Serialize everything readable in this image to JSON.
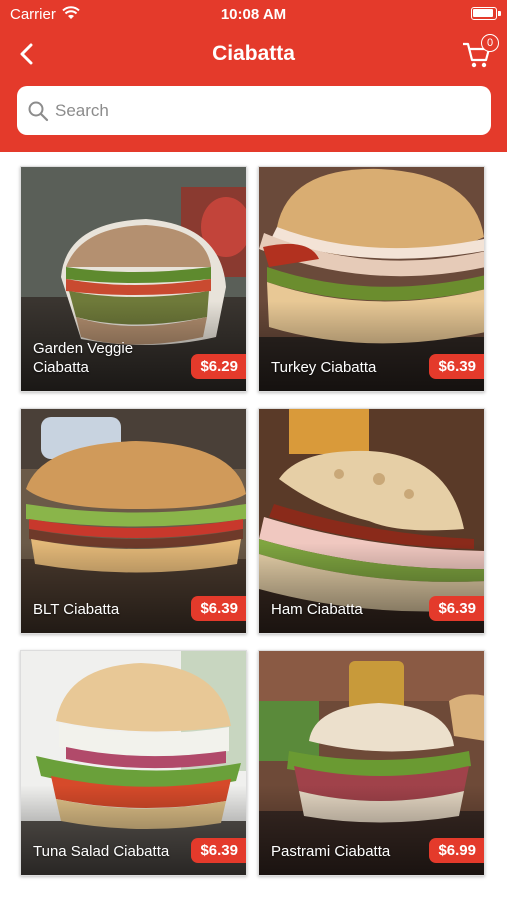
{
  "status_bar": {
    "carrier": "Carrier",
    "time": "10:08 AM"
  },
  "nav": {
    "title": "Ciabatta",
    "back_icon": "chevron-left-icon",
    "cart_icon": "cart-icon",
    "cart_count": "0"
  },
  "search": {
    "placeholder": "Search",
    "value": ""
  },
  "colors": {
    "brand": "#e43a2b",
    "white": "#ffffff"
  },
  "products": [
    {
      "name": "Garden Veggie Ciabatta",
      "price": "$6.29"
    },
    {
      "name": "Turkey Ciabatta",
      "price": "$6.39"
    },
    {
      "name": "BLT Ciabatta",
      "price": "$6.39"
    },
    {
      "name": "Ham Ciabatta",
      "price": "$6.39"
    },
    {
      "name": "Tuna Salad Ciabatta",
      "price": "$6.39"
    },
    {
      "name": "Pastrami Ciabatta",
      "price": "$6.99"
    }
  ]
}
